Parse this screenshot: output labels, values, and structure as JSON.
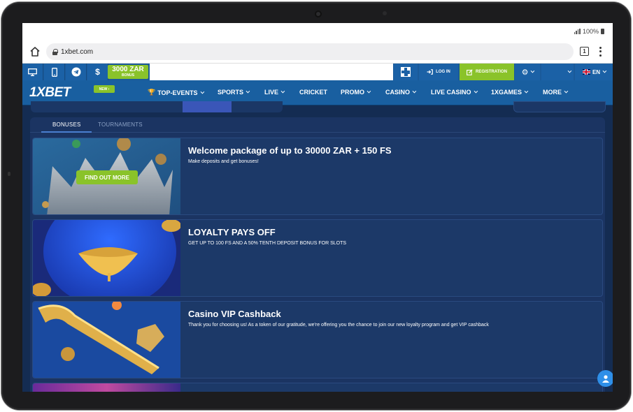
{
  "browser": {
    "status": {
      "battery": "100%"
    },
    "url": "1xbet.com",
    "tab_count": "1"
  },
  "topbar": {
    "bonus_amount": "3000 ZAR",
    "bonus_label": "BONUS",
    "login_label": "LOG IN",
    "register_label": "REGISTRATION",
    "language": "EN"
  },
  "nav": {
    "logo": "1XBET",
    "new_badge": "NEW",
    "items": [
      "TOP-EVENTS",
      "SPORTS",
      "LIVE",
      "CRICKET",
      "PROMO",
      "CASINO",
      "LIVE CASINO",
      "1XGAMES",
      "MORE"
    ]
  },
  "tabs": {
    "bonuses": "BONUSES",
    "tournaments": "TOURNAMENTS"
  },
  "cards": [
    {
      "title": "Welcome package of up to 30000 ZAR + 150 FS",
      "subtitle": "Make deposits and get bonuses!",
      "button": "FIND OUT MORE"
    },
    {
      "title": "LOYALTY PAYS OFF",
      "subtitle": "GET UP TO 100 FS AND A 50% TENTH DEPOSIT BONUS FOR SLOTS"
    },
    {
      "title": "Casino VIP Cashback",
      "subtitle": "Thank you for choosing us! As a token of our gratitude, we're offering you the chance to join our new loyalty program and get VIP cashback"
    }
  ],
  "colors": {
    "brand_blue": "#195fa0",
    "accent_green": "#8ac32a",
    "panel_bg": "#1b3462"
  }
}
